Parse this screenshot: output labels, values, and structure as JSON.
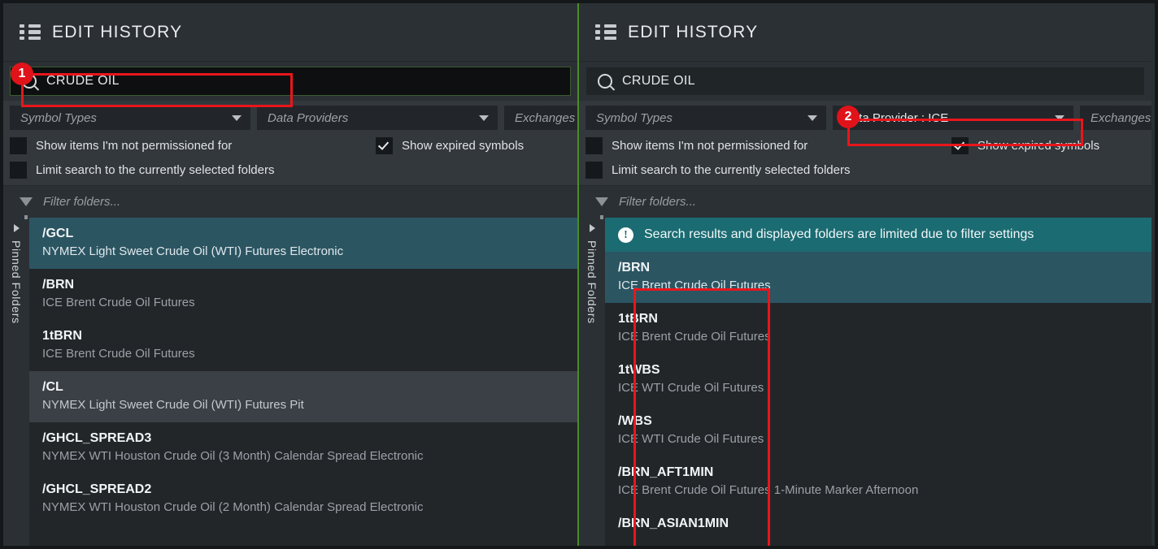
{
  "window": {
    "accent_red": "#e0131a",
    "accent_green": "#4a8b28",
    "accent_teal": "#1b6b72"
  },
  "panels": [
    {
      "id": "left",
      "header": {
        "icon": "list-icon",
        "title": "EDIT HISTORY"
      },
      "search": {
        "icon": "search-icon",
        "value": "CRUDE OIL",
        "focused": true
      },
      "filters": {
        "dropdowns": [
          {
            "name": "symbol-types",
            "label": "Symbol Types",
            "has_value": false
          },
          {
            "name": "data-providers",
            "label": "Data Providers",
            "has_value": false
          },
          {
            "name": "exchanges",
            "label": "Exchanges",
            "has_value": false
          }
        ],
        "checkboxes": [
          {
            "name": "show-not-permissioned",
            "label": "Show items I'm not permissioned for",
            "checked": false
          },
          {
            "name": "show-expired-symbols",
            "label": "Show expired symbols",
            "checked": true
          },
          {
            "name": "limit-search-folders",
            "label": "Limit search to the currently selected folders",
            "checked": false
          }
        ]
      },
      "folder_filter": {
        "icon": "funnel-icon",
        "placeholder": "Filter folders..."
      },
      "rail": {
        "label": "Pinned Folders",
        "arrow": "chevron-right-icon"
      },
      "banner": null,
      "rows": [
        {
          "symbol": "/GCL",
          "description": "NYMEX Light Sweet Crude Oil (WTI) Futures Electronic",
          "state": "selected"
        },
        {
          "symbol": "/BRN",
          "description": "ICE Brent Crude Oil Futures",
          "state": "normal"
        },
        {
          "symbol": "1tBRN",
          "description": "ICE Brent Crude Oil Futures",
          "state": "normal"
        },
        {
          "symbol": "/CL",
          "description": "NYMEX Light Sweet Crude Oil (WTI) Futures Pit",
          "state": "hover"
        },
        {
          "symbol": "/GHCL_SPREAD3",
          "description": "NYMEX WTI Houston Crude Oil (3 Month) Calendar Spread Electronic",
          "state": "normal"
        },
        {
          "symbol": "/GHCL_SPREAD2",
          "description": "NYMEX WTI Houston Crude Oil (2 Month) Calendar Spread Electronic",
          "state": "normal"
        }
      ]
    },
    {
      "id": "right",
      "header": {
        "icon": "list-icon",
        "title": "EDIT HISTORY"
      },
      "search": {
        "icon": "search-icon",
        "value": "CRUDE OIL",
        "focused": false
      },
      "filters": {
        "dropdowns": [
          {
            "name": "symbol-types",
            "label": "Symbol Types",
            "has_value": false
          },
          {
            "name": "data-providers",
            "label": "Data Provider : ICE",
            "has_value": true
          },
          {
            "name": "exchanges",
            "label": "Exchanges",
            "has_value": false
          }
        ],
        "checkboxes": [
          {
            "name": "show-not-permissioned",
            "label": "Show items I'm not permissioned for",
            "checked": false
          },
          {
            "name": "show-expired-symbols",
            "label": "Show expired symbols",
            "checked": true
          },
          {
            "name": "limit-search-folders",
            "label": "Limit search to the currently selected folders",
            "checked": false
          }
        ]
      },
      "folder_filter": {
        "icon": "funnel-icon",
        "placeholder": "Filter folders..."
      },
      "rail": {
        "label": "Pinned Folders",
        "arrow": "chevron-right-icon"
      },
      "banner": {
        "icon": "info-icon",
        "text": "Search results and displayed folders are limited due to filter settings"
      },
      "rows": [
        {
          "symbol": "/BRN",
          "description": "ICE Brent Crude Oil Futures",
          "state": "selected"
        },
        {
          "symbol": "1tBRN",
          "description": "ICE Brent Crude Oil Futures",
          "state": "normal"
        },
        {
          "symbol": "1tWBS",
          "description": "ICE WTI Crude Oil Futures",
          "state": "normal"
        },
        {
          "symbol": "/WBS",
          "description": "ICE WTI Crude Oil Futures",
          "state": "normal"
        },
        {
          "symbol": "/BRN_AFT1MIN",
          "description": "ICE Brent Crude Oil Futures 1-Minute Marker Afternoon",
          "state": "normal"
        },
        {
          "symbol": "/BRN_ASIAN1MIN",
          "description": "",
          "state": "normal"
        }
      ]
    }
  ],
  "annotations": [
    {
      "number": "1",
      "target": "search-input-left"
    },
    {
      "number": "2",
      "target": "data-provider-dropdown-right"
    }
  ]
}
